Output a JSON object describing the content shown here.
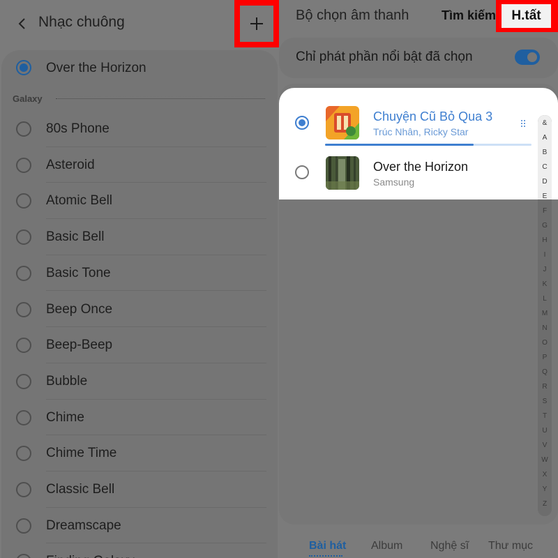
{
  "left": {
    "title": "Nhạc chuông",
    "selected": "Over the Horizon",
    "section": "Galaxy",
    "ringtones": [
      "80s Phone",
      "Asteroid",
      "Atomic Bell",
      "Basic Bell",
      "Basic Tone",
      "Beep Once",
      "Beep-Beep",
      "Bubble",
      "Chime",
      "Chime Time",
      "Classic Bell",
      "Dreamscape",
      "Finding Galaxy"
    ]
  },
  "right": {
    "title": "Bộ chọn âm thanh",
    "search_label": "Tìm kiếm",
    "done_label": "H.tất",
    "highlight_label": "Chỉ phát phần nổi bật đã chọn",
    "highlight_enabled": true,
    "songs": [
      {
        "title": "Chuyện Cũ Bỏ Qua 3",
        "artist": "Trúc Nhân, Ricky Star",
        "selected": true,
        "progress": 0.72
      },
      {
        "title": "Over the Horizon",
        "artist": "Samsung",
        "selected": false
      }
    ],
    "index_letters": [
      "&",
      "A",
      "B",
      "C",
      "D",
      "E",
      "F",
      "G",
      "H",
      "I",
      "J",
      "K",
      "L",
      "M",
      "N",
      "O",
      "P",
      "Q",
      "R",
      "S",
      "T",
      "U",
      "V",
      "W",
      "X",
      "Y",
      "Z"
    ],
    "tabs": [
      "Bài hát",
      "Album",
      "Nghệ sĩ",
      "Thư mục"
    ],
    "active_tab": "Bài hát"
  },
  "colors": {
    "accent": "#3f7fd0",
    "highlight_box": "#ff0000",
    "dim_overlay": "#7b7b7b"
  }
}
